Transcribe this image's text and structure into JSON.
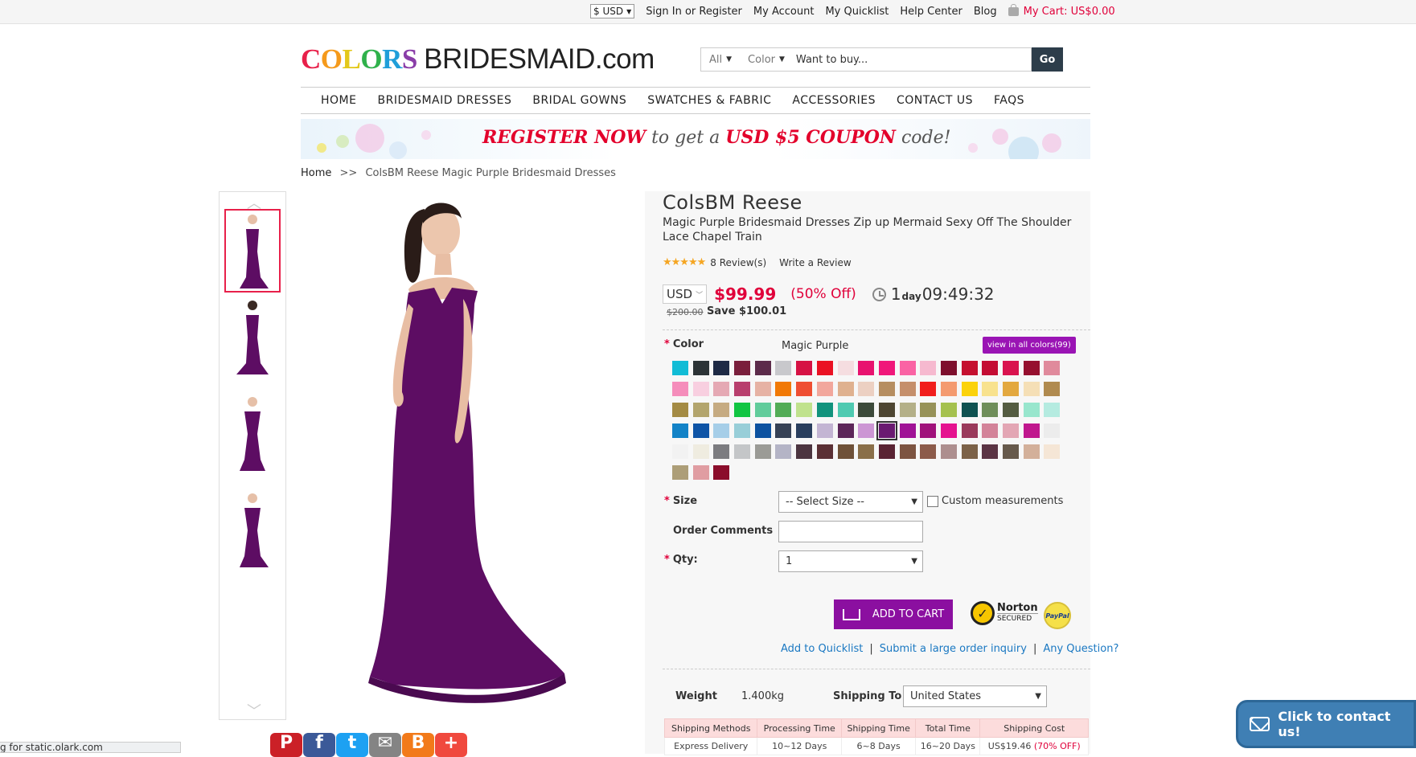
{
  "topbar": {
    "currency": "$ USD",
    "links": [
      "Sign In or Register",
      "My Account",
      "My Quicklist",
      "Help Center",
      "Blog"
    ],
    "cart": "My Cart: US$0.00"
  },
  "logo": {
    "colors": "COLORS",
    "rest": "BRIDESMAID.com"
  },
  "search": {
    "all": "All",
    "color": "Color",
    "placeholder": "Want to buy...",
    "go": "Go"
  },
  "nav": [
    "HOME",
    "BRIDESMAID DRESSES",
    "BRIDAL GOWNS",
    "SWATCHES & FABRIC",
    "ACCESSORIES",
    "CONTACT US",
    "FAQS"
  ],
  "banner": {
    "part1": "REGISTER NOW",
    "part2": " to get a ",
    "part3": "USD $5 COUPON",
    "part4": " code!"
  },
  "breadcrumb": {
    "home": "Home",
    "sep": ">>",
    "current": "ColsBM Reese Magic Purple Bridesmaid Dresses"
  },
  "product": {
    "title": "ColsBM Reese",
    "desc": "Magic Purple Bridesmaid Dresses Zip up Mermaid Sexy Off The Shoulder Lace Chapel Train",
    "rating": 5,
    "reviews": "8 Review(s)",
    "write_review": "Write a Review",
    "currency": "USD",
    "price": "$99.99",
    "off": "(50% Off)",
    "countdown_days": "1",
    "day_label": "day",
    "countdown_time": "09:49:32",
    "old_price": "$200.00",
    "save": "Save $100.01"
  },
  "color": {
    "label": "Color",
    "selected": "Magic Purple",
    "view_all": "view in all colors(99)",
    "swatches": [
      "#12bcd6",
      "#2c3336",
      "#1e2a45",
      "#7a1f3c",
      "#5c2b4a",
      "#c8c8cc",
      "#d61244",
      "#ea1123",
      "#f5dde0",
      "#e8126f",
      "#f0177a",
      "#fa63a4",
      "#f6b9cf",
      "#7e0f2d",
      "#c5102f",
      "#c40d33",
      "#d9134f",
      "#96102f",
      "#e08a9c",
      "#f58dbb",
      "#f8cfe0",
      "#e5a9b4",
      "#b83f6d",
      "#e6b2a4",
      "#f17906",
      "#ef4e32",
      "#f2a79c",
      "#dfb18f",
      "#ecd0c2",
      "#b68e61",
      "#c58f6b",
      "#f11e1c",
      "#f49a6f",
      "#fbd20a",
      "#f8e28e",
      "#e3a83f",
      "#f5dfb6",
      "#b08a4f",
      "#a48b44",
      "#b3a56d",
      "#c6ab82",
      "#12c543",
      "#61cc9b",
      "#52ac56",
      "#c0e28d",
      "#12937d",
      "#4fcab1",
      "#3c4a3a",
      "#4e4632",
      "#b4b088",
      "#979258",
      "#a5c14e",
      "#0f5251",
      "#6f8e5a",
      "#545c41",
      "#98e6cd",
      "#b5ebe0",
      "#1383c7",
      "#0e54a6",
      "#a6cee8",
      "#98ced8",
      "#0d52a0",
      "#364155",
      "#293e5d",
      "#c3b5d3",
      "#5c2659",
      "#cc96d4",
      "#6a1a71",
      "#a01296",
      "#a0127b",
      "#e5128f",
      "#9a3a5b",
      "#d38399",
      "#e3a6b4",
      "#c0178e",
      "#ececec",
      "#f2f2f2",
      "#efece0",
      "#7c7c80",
      "#c4c6c8",
      "#9b9b96",
      "#b4b4c6",
      "#4c3540",
      "#5b3035",
      "#6f5138",
      "#8a6f49",
      "#5a2333",
      "#7d5441",
      "#8c5b4a",
      "#ad8e8e",
      "#7c6248",
      "#5b3444",
      "#675a4c",
      "#d3b09a",
      "#f5e6d6",
      "#ad9e78",
      "#e09da2",
      "#8b0d2b"
    ],
    "selected_index": 67
  },
  "size": {
    "label": "Size",
    "value": "-- Select Size --",
    "custom": "Custom measurements"
  },
  "comments": {
    "label": "Order Comments"
  },
  "qty": {
    "label": "Qty:",
    "value": "1"
  },
  "actions": {
    "add_to_cart": "ADD TO CART",
    "norton": "Norton",
    "secured": "SECURED",
    "paypal": "PayPal"
  },
  "links": [
    "Add to Quicklist",
    "Submit a large order inquiry",
    "Any Question?"
  ],
  "shipping": {
    "weight_label": "Weight",
    "weight": "1.400kg",
    "ship_to_label": "Shipping To",
    "ship_to": "United States",
    "headers": [
      "Shipping Methods",
      "Processing Time",
      "Shipping Time",
      "Total Time",
      "Shipping Cost"
    ],
    "row": {
      "method": "Express Delivery",
      "processing": "10~12 Days",
      "shipping": "6~8 Days",
      "total": "16~20 Days",
      "cost": "US$19.46",
      "cost_off": "(70% OFF)"
    }
  },
  "chat": {
    "label": "Click to contact us!"
  },
  "status": "g for static.olark.com"
}
